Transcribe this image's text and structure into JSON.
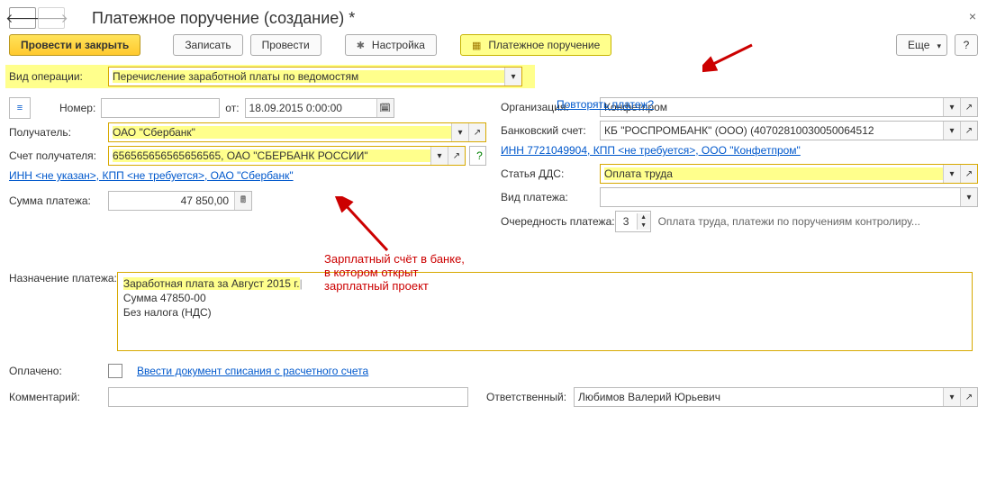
{
  "title": "Платежное поручение (создание) *",
  "toolbar": {
    "post_close": "Провести и закрыть",
    "write": "Записать",
    "post": "Провести",
    "settings": "Настройка",
    "pay_order": "Платежное поручение",
    "more": "Еще",
    "help": "?"
  },
  "labels": {
    "op_type": "Вид операции:",
    "number": "Номер:",
    "from": "от:",
    "recipient": "Получатель:",
    "recip_account": "Счет получателя:",
    "pay_sum": "Сумма платежа:",
    "purpose": "Назначение платежа:",
    "paid": "Оплачено:",
    "comment": "Комментарий:",
    "repeat": "Повторять платеж?",
    "org": "Организация:",
    "bank_acc": "Банковский счет:",
    "dds": "Статья ДДС:",
    "pay_type": "Вид платежа:",
    "priority": "Очередность платежа:",
    "responsible": "Ответственный:"
  },
  "values": {
    "op_type": "Перечисление заработной платы по ведомостям",
    "number": "",
    "date": "18.09.2015  0:00:00",
    "recipient": "ОАО \"Сбербанк\"",
    "recip_account": "656565656565656565, ОАО \"СБЕРБАНК РОССИИ\"",
    "recip_link": "ИНН <не указан>, КПП <не требуется>, ОАО \"Сбербанк\"",
    "pay_sum": "47 850,00",
    "purpose_l1": "Заработная плата за Август 2015 г.",
    "purpose_l2": "Сумма 47850-00",
    "purpose_l3": "Без налога (НДС)",
    "paid_link": "Ввести документ списания с расчетного счета",
    "org": "Конфетпром",
    "bank_acc": "КБ \"РОСПРОМБАНК\" (ООО) (40702810030050064512",
    "org_link": "ИНН 7721049904, КПП <не требуется>, ООО \"Конфетпром\"",
    "dds": "Оплата труда",
    "priority_num": "3",
    "priority_text": "Оплата труда, платежи по поручениям контролиру...",
    "responsible": "Любимов Валерий Юрьевич"
  },
  "annotation": {
    "text1": "Зарплатный счёт в банке,",
    "text2": "в котором открыт",
    "text3": "зарплатный проект"
  }
}
